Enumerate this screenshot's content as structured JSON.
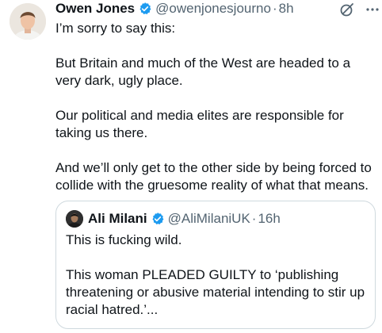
{
  "tweet": {
    "author_name": "Owen Jones",
    "handle": "@owenjonesjourno",
    "separator": "·",
    "time": "8h",
    "paragraphs": [
      "I’m sorry to say this:",
      "But Britain and much of the West are headed to a very dark, ugly place.",
      "Our political and media elites are responsible for taking us there.",
      "And we’ll only get to the other side by being forced to collide with the gruesome reality of what that means."
    ]
  },
  "quote": {
    "author_name": "Ali Milani",
    "handle": "@AliMilaniUK",
    "separator": "·",
    "time": "16h",
    "paragraphs": [
      "This is fucking wild.",
      "This woman PLEADED GUILTY to ‘publishing threatening or abusive material intending to stir up racial hatred.’..."
    ]
  },
  "colors": {
    "verified": "#1d9bf0",
    "secondary_text": "#536471",
    "border": "#cfd9de"
  },
  "icons": {
    "verified": "verified-badge-icon",
    "grok": "grok-icon",
    "more": "more-icon"
  }
}
